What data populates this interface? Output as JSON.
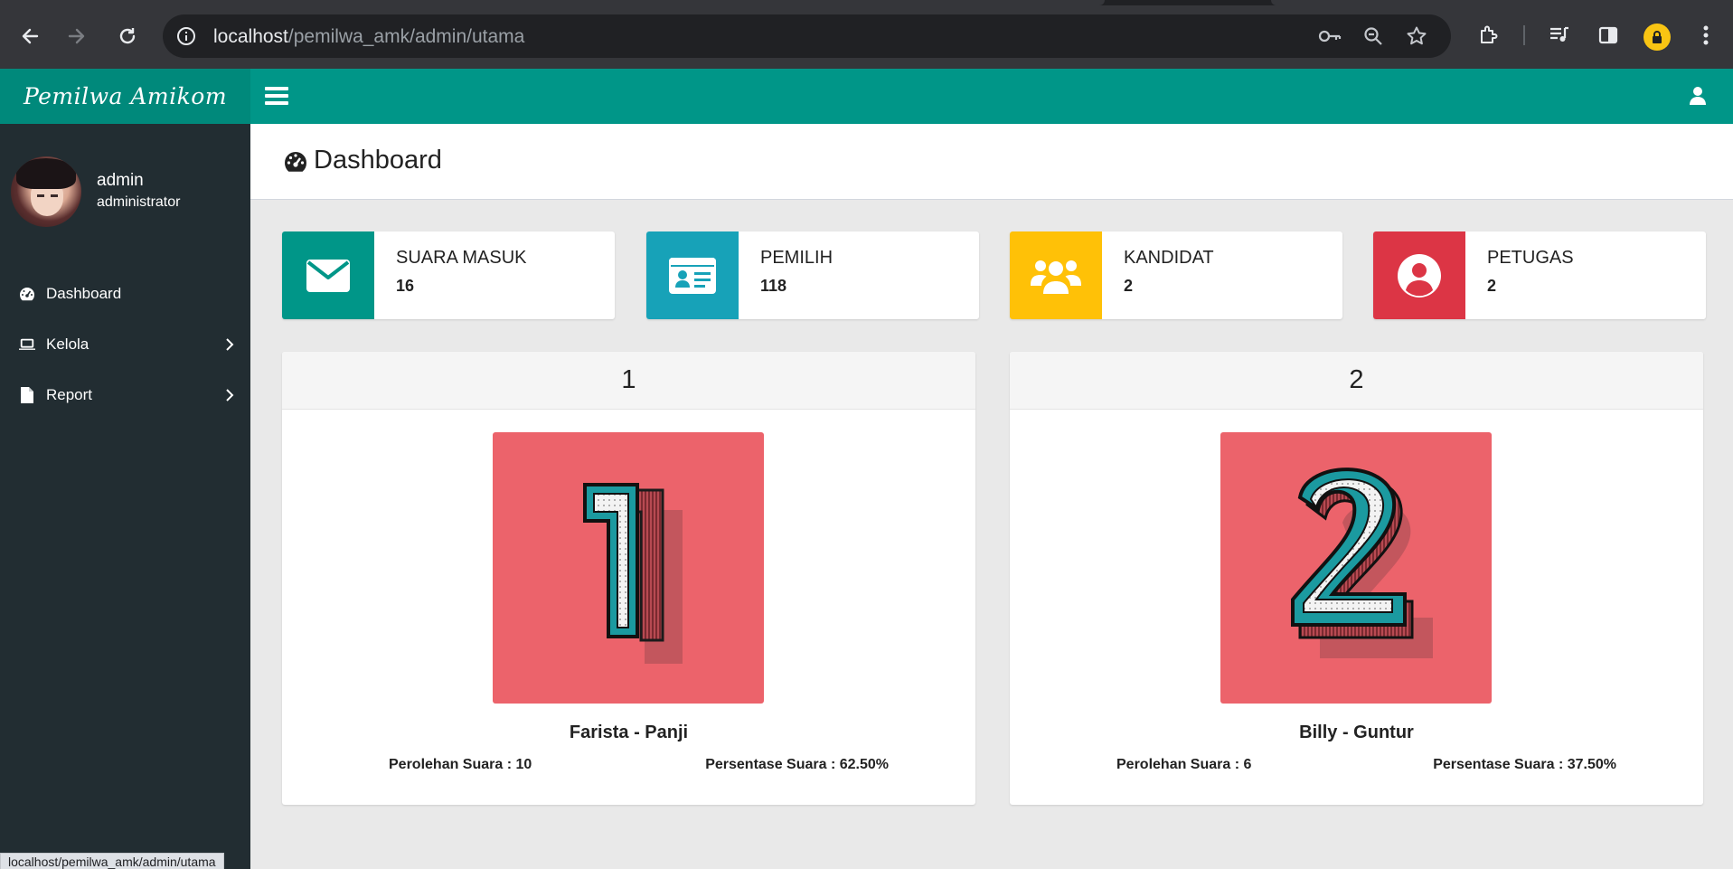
{
  "browser": {
    "url_host": "localhost",
    "url_path": "/pemilwa_amk/admin/utama",
    "status_url": "localhost/pemilwa_amk/admin/utama"
  },
  "app": {
    "logo": "Pemilwa Amikom"
  },
  "user": {
    "name": "admin",
    "role": "administrator"
  },
  "sidebar": {
    "items": [
      {
        "label": "Dashboard",
        "icon": "dashboard-icon"
      },
      {
        "label": "Kelola",
        "icon": "laptop-icon",
        "has_children": true
      },
      {
        "label": "Report",
        "icon": "file-icon",
        "has_children": true
      }
    ]
  },
  "page": {
    "title": "Dashboard"
  },
  "stats": [
    {
      "label": "SUARA MASUK",
      "value": "16",
      "color": "#009688",
      "icon": "envelope-icon"
    },
    {
      "label": "PEMILIH",
      "value": "118",
      "color": "#17a2b8",
      "icon": "id-card-icon"
    },
    {
      "label": "KANDIDAT",
      "value": "2",
      "color": "#ffc107",
      "icon": "users-icon"
    },
    {
      "label": "PETUGAS",
      "value": "2",
      "color": "#dc3545",
      "icon": "user-circle-icon"
    }
  ],
  "candidates": [
    {
      "number": "1",
      "name": "Farista - Panji",
      "votes": "Perolehan Suara : 10",
      "percent": "Persentase Suara : 62.50%"
    },
    {
      "number": "2",
      "name": "Billy - Guntur",
      "votes": "Perolehan Suara : 6",
      "percent": "Persentase Suara : 37.50%"
    }
  ],
  "colors": {
    "header": "#009688",
    "logo_bar": "#00897b",
    "sidebar": "#222d32",
    "candidate_bg": "#ec636b",
    "numeral_teal": "#1b9aa0"
  }
}
